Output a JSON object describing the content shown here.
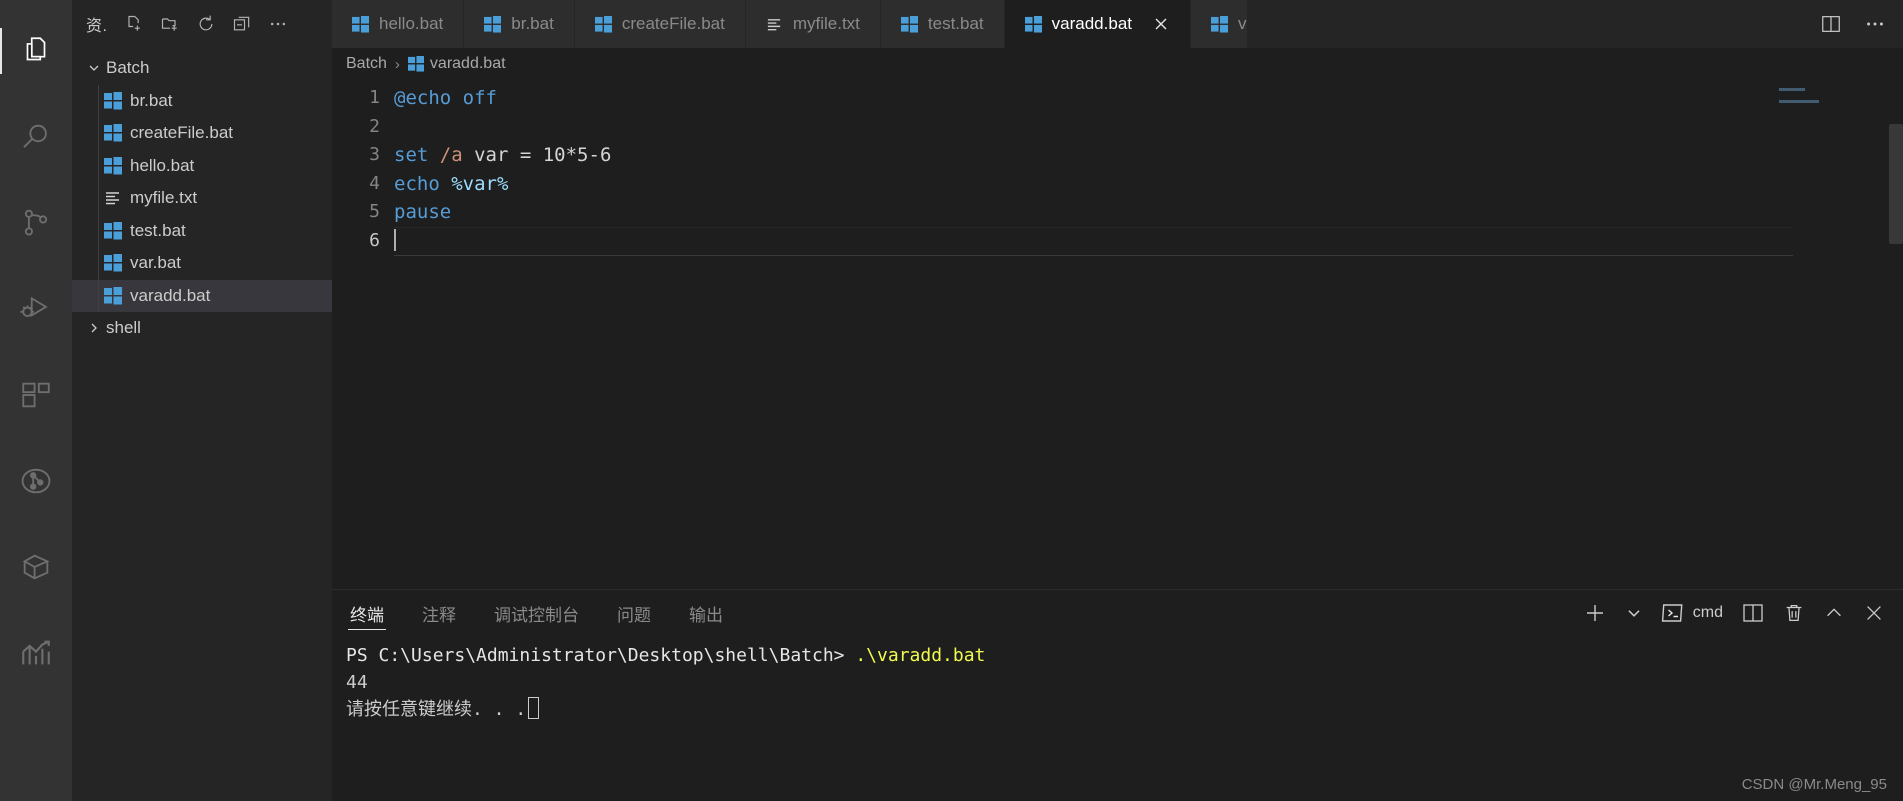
{
  "activitybar": {
    "items": [
      {
        "name": "explorer",
        "icon": "files-icon",
        "active": true
      },
      {
        "name": "search",
        "icon": "search-icon",
        "active": false
      },
      {
        "name": "source-control",
        "icon": "source-control-icon",
        "active": false
      },
      {
        "name": "run-and-debug",
        "icon": "run-debug-icon",
        "active": false
      },
      {
        "name": "extensions",
        "icon": "extensions-icon",
        "active": false
      },
      {
        "name": "git-graph",
        "icon": "git-graph-icon",
        "active": false
      },
      {
        "name": "remote-explorer",
        "icon": "box-icon",
        "active": false
      },
      {
        "name": "analytics",
        "icon": "chart-icon",
        "active": false
      }
    ]
  },
  "sidebar": {
    "title": "资.",
    "actions": [
      {
        "name": "new-file",
        "icon": "new-file-icon"
      },
      {
        "name": "new-folder",
        "icon": "new-folder-icon"
      },
      {
        "name": "refresh-explorer",
        "icon": "refresh-icon"
      },
      {
        "name": "collapse-folders",
        "icon": "collapse-all-icon"
      },
      {
        "name": "explorer-more-actions",
        "icon": "ellipsis-icon"
      }
    ],
    "tree": [
      {
        "label": "Batch",
        "type": "folder",
        "expanded": true,
        "icon": "chevron-down-icon",
        "selected": false
      },
      {
        "label": "br.bat",
        "type": "file",
        "icon": "windows-bat-icon",
        "selected": false
      },
      {
        "label": "createFile.bat",
        "type": "file",
        "icon": "windows-bat-icon",
        "selected": false
      },
      {
        "label": "hello.bat",
        "type": "file",
        "icon": "windows-bat-icon",
        "selected": false
      },
      {
        "label": "myfile.txt",
        "type": "file",
        "icon": "text-file-icon",
        "selected": false
      },
      {
        "label": "test.bat",
        "type": "file",
        "icon": "windows-bat-icon",
        "selected": false
      },
      {
        "label": "var.bat",
        "type": "file",
        "icon": "windows-bat-icon",
        "selected": false
      },
      {
        "label": "varadd.bat",
        "type": "file",
        "icon": "windows-bat-icon",
        "selected": true
      },
      {
        "label": "shell",
        "type": "folder",
        "expanded": false,
        "icon": "chevron-right-icon",
        "selected": false
      }
    ]
  },
  "tabs": {
    "items": [
      {
        "label": "hello.bat",
        "icon": "windows-bat-icon",
        "active": false,
        "closable": false
      },
      {
        "label": "br.bat",
        "icon": "windows-bat-icon",
        "active": false,
        "closable": false
      },
      {
        "label": "createFile.bat",
        "icon": "windows-bat-icon",
        "active": false,
        "closable": false
      },
      {
        "label": "myfile.txt",
        "icon": "text-file-icon",
        "active": false,
        "closable": false
      },
      {
        "label": "test.bat",
        "icon": "windows-bat-icon",
        "active": false,
        "closable": false
      },
      {
        "label": "varadd.bat",
        "icon": "windows-bat-icon",
        "active": true,
        "closable": true
      },
      {
        "label": "v",
        "icon": "windows-bat-icon",
        "active": false,
        "closable": false
      }
    ],
    "actions": [
      {
        "name": "split-editor",
        "icon": "split-editor-icon"
      },
      {
        "name": "editor-more-actions",
        "icon": "ellipsis-icon"
      }
    ]
  },
  "breadcrumb": {
    "folder": "Batch",
    "separator": "›",
    "file": "varadd.bat"
  },
  "editor": {
    "filename": "varadd.bat",
    "lines": [
      {
        "number": "1",
        "segments": [
          {
            "t": "@echo off",
            "c": "tok-kw"
          }
        ]
      },
      {
        "number": "2",
        "segments": []
      },
      {
        "number": "3",
        "segments": [
          {
            "t": "set",
            "c": "tok-kw"
          },
          {
            "t": " ",
            "c": "tok-op"
          },
          {
            "t": "/a",
            "c": "tok-flag"
          },
          {
            "t": " var = 10*5-6",
            "c": "tok-num"
          }
        ]
      },
      {
        "number": "4",
        "segments": [
          {
            "t": "echo",
            "c": "tok-kw"
          },
          {
            "t": " ",
            "c": "tok-op"
          },
          {
            "t": "%var%",
            "c": "tok-var"
          }
        ]
      },
      {
        "number": "5",
        "segments": [
          {
            "t": "pause",
            "c": "tok-kw"
          }
        ]
      },
      {
        "number": "6",
        "segments": [],
        "cursor": true
      }
    ]
  },
  "panel": {
    "tabs": [
      {
        "label": "终端",
        "active": true
      },
      {
        "label": "注释",
        "active": false
      },
      {
        "label": "调试控制台",
        "active": false
      },
      {
        "label": "问题",
        "active": false
      },
      {
        "label": "输出",
        "active": false
      }
    ],
    "actions": [
      {
        "name": "new-terminal",
        "icon": "plus-icon"
      },
      {
        "name": "terminal-profile-dropdown",
        "icon": "chevron-down-icon"
      },
      {
        "name": "terminal-shell-indicator",
        "icon": "terminal-icon",
        "label": "cmd"
      },
      {
        "name": "split-terminal",
        "icon": "split-editor-icon"
      },
      {
        "name": "kill-terminal",
        "icon": "trash-icon"
      },
      {
        "name": "maximize-panel",
        "icon": "chevron-up-icon"
      },
      {
        "name": "close-panel",
        "icon": "close-icon"
      }
    ],
    "terminal": {
      "prompt": "PS C:\\Users\\Administrator\\Desktop\\shell\\Batch> ",
      "command": ".\\varadd.bat",
      "output": [
        "44",
        "请按任意键继续. . ."
      ]
    }
  },
  "watermark": "CSDN @Mr.Meng_95",
  "colors": {
    "accent_blue": "#569cd6",
    "var_blue": "#9cdcfe",
    "flag_orange": "#ce9178",
    "terminal_yellow": "#f1fa4e",
    "bat_icon_blue": "#4a9fd8",
    "editor_bg": "#1e1e1e",
    "sidebar_bg": "#252526",
    "activitybar_bg": "#333333",
    "selection_bg": "#37373d"
  }
}
